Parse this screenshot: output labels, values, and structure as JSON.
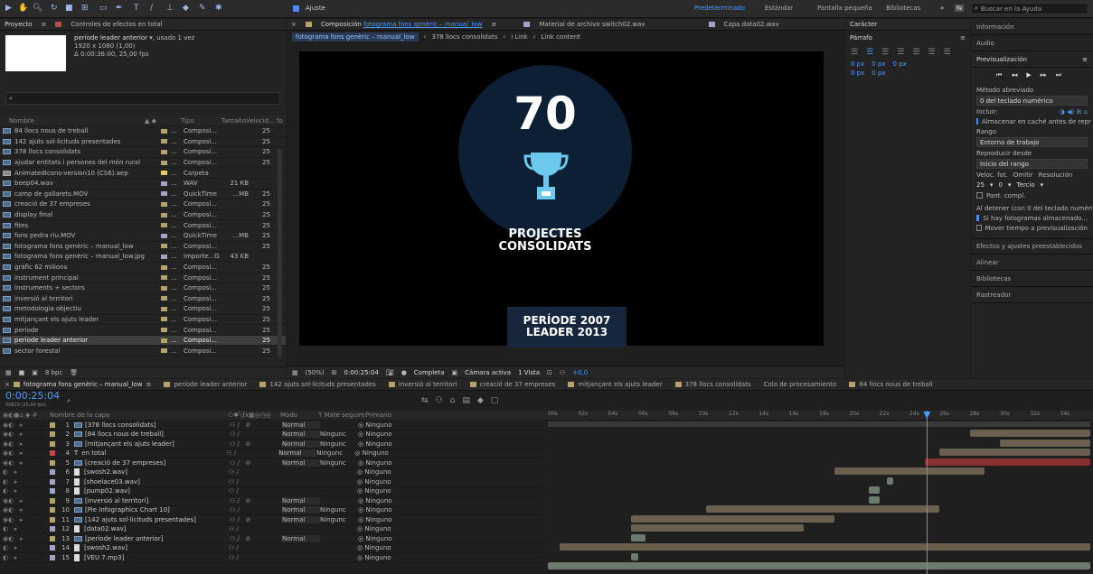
{
  "topbar": {
    "snapping_label": "Ajuste",
    "workspaces": [
      "Predeterminado",
      "Estándar",
      "Pantalla pequeña",
      "Bibliotecas"
    ],
    "search_placeholder": "Buscar en la Ayuda"
  },
  "project_panel": {
    "tab_project": "Proyecto",
    "tab_effects": "Controles de efectos en total",
    "selected_name": "període leader anterior",
    "selected_usage": ", usado 1 vez",
    "selected_dims": "1920 x 1080 (1,00)",
    "selected_duration": "Δ 0:00:36:00, 25,00 fps",
    "search_placeholder": "",
    "columns": {
      "name": "Nombre",
      "type": "Tipo",
      "size": "Tamaño",
      "fps": "Velocid... fo"
    },
    "items": [
      {
        "name": "84 llocs nous de treball",
        "type": "Composi...",
        "size": "",
        "fps": "25",
        "color": "#b4a46a"
      },
      {
        "name": "142 ajuts sol·licituds presentades",
        "type": "Composi...",
        "size": "",
        "fps": "25",
        "color": "#b4a46a"
      },
      {
        "name": "378 llocs consolidats",
        "type": "Composi...",
        "size": "",
        "fps": "25",
        "color": "#b4a46a"
      },
      {
        "name": "ajudar entitats i persones del món rural",
        "type": "Composi...",
        "size": "",
        "fps": "25",
        "color": "#b4a46a"
      },
      {
        "name": "AnimatedIcons-version10 (CS6).aep",
        "type": "Carpeta",
        "size": "",
        "fps": "",
        "color": "#e3d15a"
      },
      {
        "name": "beep04.wav",
        "type": "WAV",
        "size": "21 KB",
        "fps": "",
        "color": "#a1a3c9"
      },
      {
        "name": "camp de gallarets.MOV",
        "type": "QuickTime",
        "size": "...MB",
        "fps": "25",
        "color": "#a1a3c9"
      },
      {
        "name": "creació de 37 empreses",
        "type": "Composi...",
        "size": "",
        "fps": "25",
        "color": "#b4a46a"
      },
      {
        "name": "display final",
        "type": "Composi...",
        "size": "",
        "fps": "25",
        "color": "#b4a46a"
      },
      {
        "name": "fites",
        "type": "Composi...",
        "size": "",
        "fps": "25",
        "color": "#b4a46a"
      },
      {
        "name": "fons pedra riu.MOV",
        "type": "QuickTime",
        "size": "...MB",
        "fps": "25",
        "color": "#a1a3c9"
      },
      {
        "name": "fotograma fons genèric – manual_low",
        "type": "Composi...",
        "size": "",
        "fps": "25",
        "color": "#b4a46a"
      },
      {
        "name": "fotograma fons genèric – manual_low.jpg",
        "type": "Importe...G",
        "size": "43 KB",
        "fps": "",
        "color": "#a1a3c9"
      },
      {
        "name": "gràfic 62 milions",
        "type": "Composi...",
        "size": "",
        "fps": "25",
        "color": "#b4a46a"
      },
      {
        "name": "instrument principal",
        "type": "Composi...",
        "size": "",
        "fps": "25",
        "color": "#b4a46a"
      },
      {
        "name": "instruments + sectors",
        "type": "Composi...",
        "size": "",
        "fps": "25",
        "color": "#b4a46a"
      },
      {
        "name": "inversió al territori",
        "type": "Composi...",
        "size": "",
        "fps": "25",
        "color": "#b4a46a"
      },
      {
        "name": "metodologia objectiu",
        "type": "Composi...",
        "size": "",
        "fps": "25",
        "color": "#b4a46a"
      },
      {
        "name": "mitjançant els ajuts leader",
        "type": "Composi...",
        "size": "",
        "fps": "25",
        "color": "#b4a46a"
      },
      {
        "name": "període",
        "type": "Composi...",
        "size": "",
        "fps": "25",
        "color": "#b4a46a"
      },
      {
        "name": "període leader anterior",
        "type": "Composi...",
        "size": "",
        "fps": "25",
        "color": "#b4a46a",
        "selected": true
      },
      {
        "name": "sector forestal",
        "type": "Composi...",
        "size": "",
        "fps": "25",
        "color": "#b4a46a"
      }
    ],
    "bpc_label": "8 bpc"
  },
  "viewer": {
    "tab_composition_prefix": "Composición",
    "tab_composition_name": "fotograma fons genèric – manual_low",
    "tab_material": "Material de archivo switch02.wav",
    "tab_layer": "Capa data02.wav",
    "breadcrumbs": [
      "fotograma fons genèric – manual_low",
      "378 llocs consolidats",
      "i Link",
      "Link content"
    ],
    "big_number": "70",
    "line1": "PROJECTES",
    "line2": "CONSOLIDATS",
    "period_line1_a": "PERÍODE",
    "period_line1_b": "2007",
    "period_line2_a": "LEADER",
    "period_line2_b": "2013",
    "zoom": "(50%)",
    "timecode": "0:00:25:04",
    "quality": "Completa",
    "camera": "Cámara activa",
    "views": "1 Vista",
    "exposure": "+0,0"
  },
  "character_panel": {
    "tab_char": "Carácter",
    "tab_paragraph": "Párrafo",
    "px_values": [
      "0 px",
      "0 px",
      "0 px",
      "0 px",
      "0 px"
    ]
  },
  "right_panel": {
    "info": "Información",
    "audio": "Audio",
    "preview": "Previsualización",
    "shortcut_label": "Método abreviado",
    "shortcut_value": "0 del teclado numérico",
    "include_label": "Incluir:",
    "cache_label": "Almacenar en caché antes de repr",
    "range_label": "Rango",
    "range_value": "Entorno de trabajo",
    "play_from_label": "Reproducir desde",
    "play_from_value": "Inicio del rango",
    "fps_label": "Veloc. fot.",
    "skip_label": "Omitir",
    "res_label": "Resolución",
    "fps_value": "25",
    "skip_value": "0",
    "res_value": "Tercio",
    "fullscreen_label": "Pant. compl.",
    "stop_label": "Al detener (con 0 del teclado numéri",
    "stop_opt1": "Si hay fotogramas almacenado...",
    "stop_opt2": "Mover tiempo a previsualización",
    "effects": "Efectos y ajustes preestablecidos",
    "align": "Alinear",
    "libraries": "Bibliotecas",
    "tracker": "Rastreador"
  },
  "timeline": {
    "tabs": [
      "fotograma fons genèric – manual_low",
      "període leader anterior",
      "142 ajuts sol·licituds presentades",
      "inversió al territori",
      "creació de 37 empreses",
      "mitjançant els ajuts leader",
      "378 llocs consolidats",
      "Cola de procesamiento",
      "84 llocs nous de treball"
    ],
    "tab_colors": [
      "#b4a46a",
      "#b4a46a",
      "#b4a46a",
      "#b4a46a",
      "#b4a46a",
      "#b4a46a",
      "#b4a46a",
      "",
      "#b4a46a"
    ],
    "timecode": "0:00:25:04",
    "frames": "00629 (25,00 fps)",
    "col_name": "Nombre de la capa",
    "col_mode": "Modo",
    "col_track": "T  Mate seguim.",
    "col_parent": "Primario",
    "ruler": [
      "00s",
      "02s",
      "04s",
      "06s",
      "08s",
      "10s",
      "12s",
      "14s",
      "16s",
      "18s",
      "20s",
      "22s",
      "24s",
      "26s",
      "28s",
      "30s",
      "32s",
      "34s"
    ],
    "playhead_seconds": 25.16,
    "duration_seconds": 36,
    "layers": [
      {
        "num": "1",
        "name": "[378 llocs consolidats]",
        "kind": "comp",
        "mode": "Normal",
        "track": "",
        "parent": "Ninguno",
        "color": "#b4a46a",
        "start": 28,
        "end": 36
      },
      {
        "num": "2",
        "name": "[84 llocs nous de treball]",
        "kind": "comp",
        "mode": "Normal",
        "track": "Ningunc",
        "parent": "Ninguno",
        "color": "#b4a46a",
        "start": 30,
        "end": 36
      },
      {
        "num": "3",
        "name": "[mitjançant els ajuts leader]",
        "kind": "comp",
        "mode": "Normal",
        "track": "Ningunc",
        "parent": "Ninguno",
        "color": "#b4a46a",
        "start": 26,
        "end": 36
      },
      {
        "num": "4",
        "name": "en total",
        "kind": "text",
        "mode": "Normal",
        "track": "Ningunc",
        "parent": "Ninguno",
        "color": "#c44a4a",
        "start": 25,
        "end": 36
      },
      {
        "num": "5",
        "name": "[creació de 37 empreses]",
        "kind": "comp",
        "mode": "Normal",
        "track": "Ningunc",
        "parent": "Ninguno",
        "color": "#b4a46a",
        "start": 19,
        "end": 29
      },
      {
        "num": "6",
        "name": "[swosh2.wav]",
        "kind": "audio",
        "mode": "",
        "track": "",
        "parent": "Ninguno",
        "color": "#a1a3c9",
        "start": 22.5,
        "end": 22.9
      },
      {
        "num": "7",
        "name": "[shoelace03.wav]",
        "kind": "audio",
        "mode": "",
        "track": "",
        "parent": "Ninguno",
        "color": "#a1a3c9",
        "start": 21.3,
        "end": 22.0
      },
      {
        "num": "8",
        "name": "[pump02.wav]",
        "kind": "audio",
        "mode": "",
        "track": "",
        "parent": "Ninguno",
        "color": "#a1a3c9",
        "start": 21.3,
        "end": 22.0
      },
      {
        "num": "9",
        "name": "[inversió al territori]",
        "kind": "comp",
        "mode": "Normal",
        "track": "",
        "parent": "Ninguno",
        "color": "#b4a46a",
        "start": 10.5,
        "end": 26
      },
      {
        "num": "10",
        "name": "[Pie Infographics Chart 10]",
        "kind": "comp",
        "mode": "Normal",
        "track": "Ningunc",
        "parent": "Ninguno",
        "color": "#b4a46a",
        "start": 5.5,
        "end": 19
      },
      {
        "num": "11",
        "name": "[142 ajuts sol·licituds presentades]",
        "kind": "comp",
        "mode": "Normal",
        "track": "Ningunc",
        "parent": "Ninguno",
        "color": "#b4a46a",
        "start": 5.5,
        "end": 17
      },
      {
        "num": "12",
        "name": "[data02.wav]",
        "kind": "audio",
        "mode": "",
        "track": "",
        "parent": "Ninguno",
        "color": "#a1a3c9",
        "start": 5.5,
        "end": 6.5
      },
      {
        "num": "13",
        "name": "[període leader anterior]",
        "kind": "comp",
        "mode": "Normal",
        "track": "",
        "parent": "Ninguno",
        "color": "#b4a46a",
        "start": 0.8,
        "end": 36
      },
      {
        "num": "14",
        "name": "[swosh2.wav]",
        "kind": "audio",
        "mode": "",
        "track": "",
        "parent": "Ninguno",
        "color": "#a1a3c9",
        "start": 5.5,
        "end": 6.0
      },
      {
        "num": "15",
        "name": "[VEU 7.mp3]",
        "kind": "audio",
        "mode": "",
        "track": "",
        "parent": "Ninguno",
        "color": "#a1a3c9",
        "start": 0,
        "end": 36
      }
    ]
  }
}
